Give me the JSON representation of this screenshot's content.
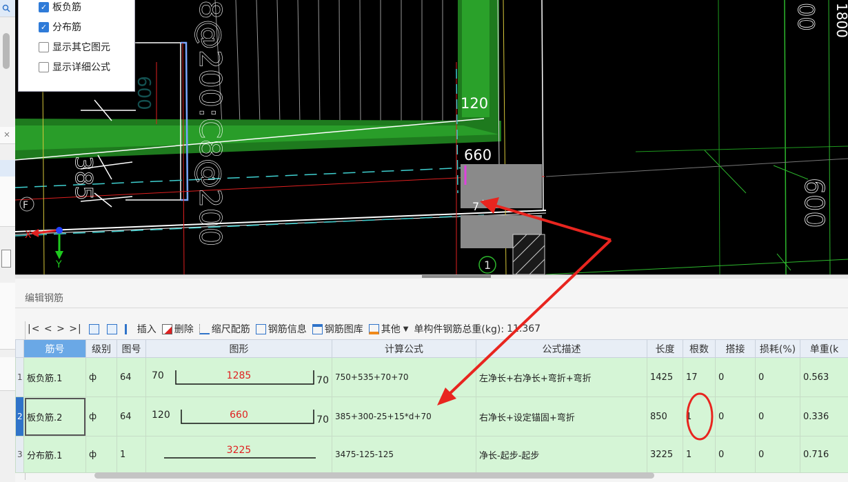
{
  "layers": {
    "items": [
      {
        "label": "板负筋",
        "checked": true
      },
      {
        "label": "分布筋",
        "checked": true
      },
      {
        "label": "显示其它图元",
        "checked": false
      },
      {
        "label": "显示详细公式",
        "checked": false
      }
    ]
  },
  "canvas": {
    "rebar_text_1": "8@200:C8@200",
    "dim_385": "385",
    "dim_120": "120",
    "dim_660": "660",
    "dim_7": "7",
    "dim_600_right": "600",
    "dim_1800": "1800",
    "dim_600_faded": "600",
    "axis_x": "X",
    "axis_y": "Y",
    "axis_f": "F",
    "axis_bubble_1": "1"
  },
  "panel": {
    "title": "编辑钢筋",
    "toolbar": {
      "nav": "|<  <  >  >|",
      "insert": "插入",
      "delete": "删除",
      "scale": "缩尺配筋",
      "info": "钢筋信息",
      "library": "钢筋图库",
      "other": "其他",
      "total_label": "单构件钢筋总重(kg):",
      "total_value": "11.367"
    },
    "columns": [
      "筋号",
      "级别",
      "图号",
      "图形",
      "计算公式",
      "公式描述",
      "长度",
      "根数",
      "搭接",
      "损耗(%)",
      "单重(k"
    ],
    "rows": [
      {
        "index": "1",
        "name": "板负筋.1",
        "grade": "ф",
        "fig": "64",
        "shape_left": "70",
        "shape_mid": "1285",
        "shape_right": "70",
        "formula": "750+535+70+70",
        "desc": "左净长+右净长+弯折+弯折",
        "length": "1425",
        "count": "17",
        "lap": "0",
        "loss": "0",
        "unit_weight": "0.563"
      },
      {
        "index": "2",
        "name": "板负筋.2",
        "grade": "ф",
        "fig": "64",
        "shape_left": "120",
        "shape_mid": "660",
        "shape_right": "70",
        "formula": "385+300-25+15*d+70",
        "desc": "右净长+设定锚固+弯折",
        "length": "850",
        "count": "1",
        "lap": "0",
        "loss": "0",
        "unit_weight": "0.336"
      },
      {
        "index": "3",
        "name": "分布筋.1",
        "grade": "ф",
        "fig": "1",
        "shape_left": "",
        "shape_mid": "3225",
        "shape_right": "",
        "formula": "3475-125-125",
        "desc": "净长-起步-起步",
        "length": "3225",
        "count": "1",
        "lap": "0",
        "loss": "0",
        "unit_weight": "0.716"
      }
    ]
  },
  "colors": {
    "accent_blue": "#2f7bd8",
    "row_green": "#d5f5d6",
    "annotation_red": "#e8251f"
  }
}
